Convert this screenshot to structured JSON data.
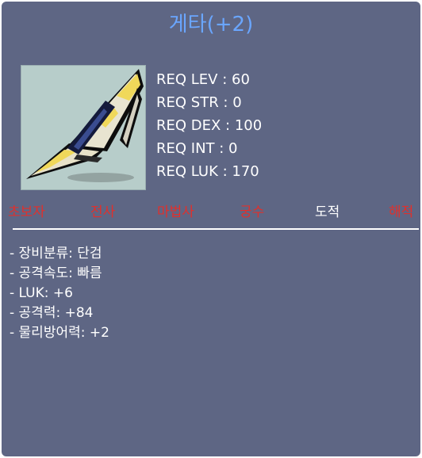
{
  "item": {
    "title": "게타(+2)",
    "icon": "dagger-icon"
  },
  "requirements": [
    {
      "label": "REQ LEV : 60"
    },
    {
      "label": "REQ STR : 0"
    },
    {
      "label": "REQ DEX : 100"
    },
    {
      "label": "REQ INT : 0"
    },
    {
      "label": "REQ LUK : 170"
    }
  ],
  "jobs": [
    {
      "label": "초보자",
      "color": "#e0302c",
      "allowed": false
    },
    {
      "label": "전사",
      "color": "#e0302c",
      "allowed": false
    },
    {
      "label": "마법사",
      "color": "#e0302c",
      "allowed": false
    },
    {
      "label": "궁수",
      "color": "#e0302c",
      "allowed": false
    },
    {
      "label": "도적",
      "color": "#ffffff",
      "allowed": true
    },
    {
      "label": "해적",
      "color": "#e0302c",
      "allowed": false
    }
  ],
  "stats": [
    {
      "label": "- 장비분류: 단검"
    },
    {
      "label": "- 공격속도: 빠름"
    },
    {
      "label": "- LUK: +6"
    },
    {
      "label": "- 공격력: +84"
    },
    {
      "label": "- 물리방어력: +2"
    }
  ],
  "colors": {
    "panel_background": "#5e6684",
    "title": "#6aa6ff",
    "allowed_job": "#ffffff",
    "disallowed_job": "#e0302c",
    "icon_background": "#b7cdca"
  }
}
